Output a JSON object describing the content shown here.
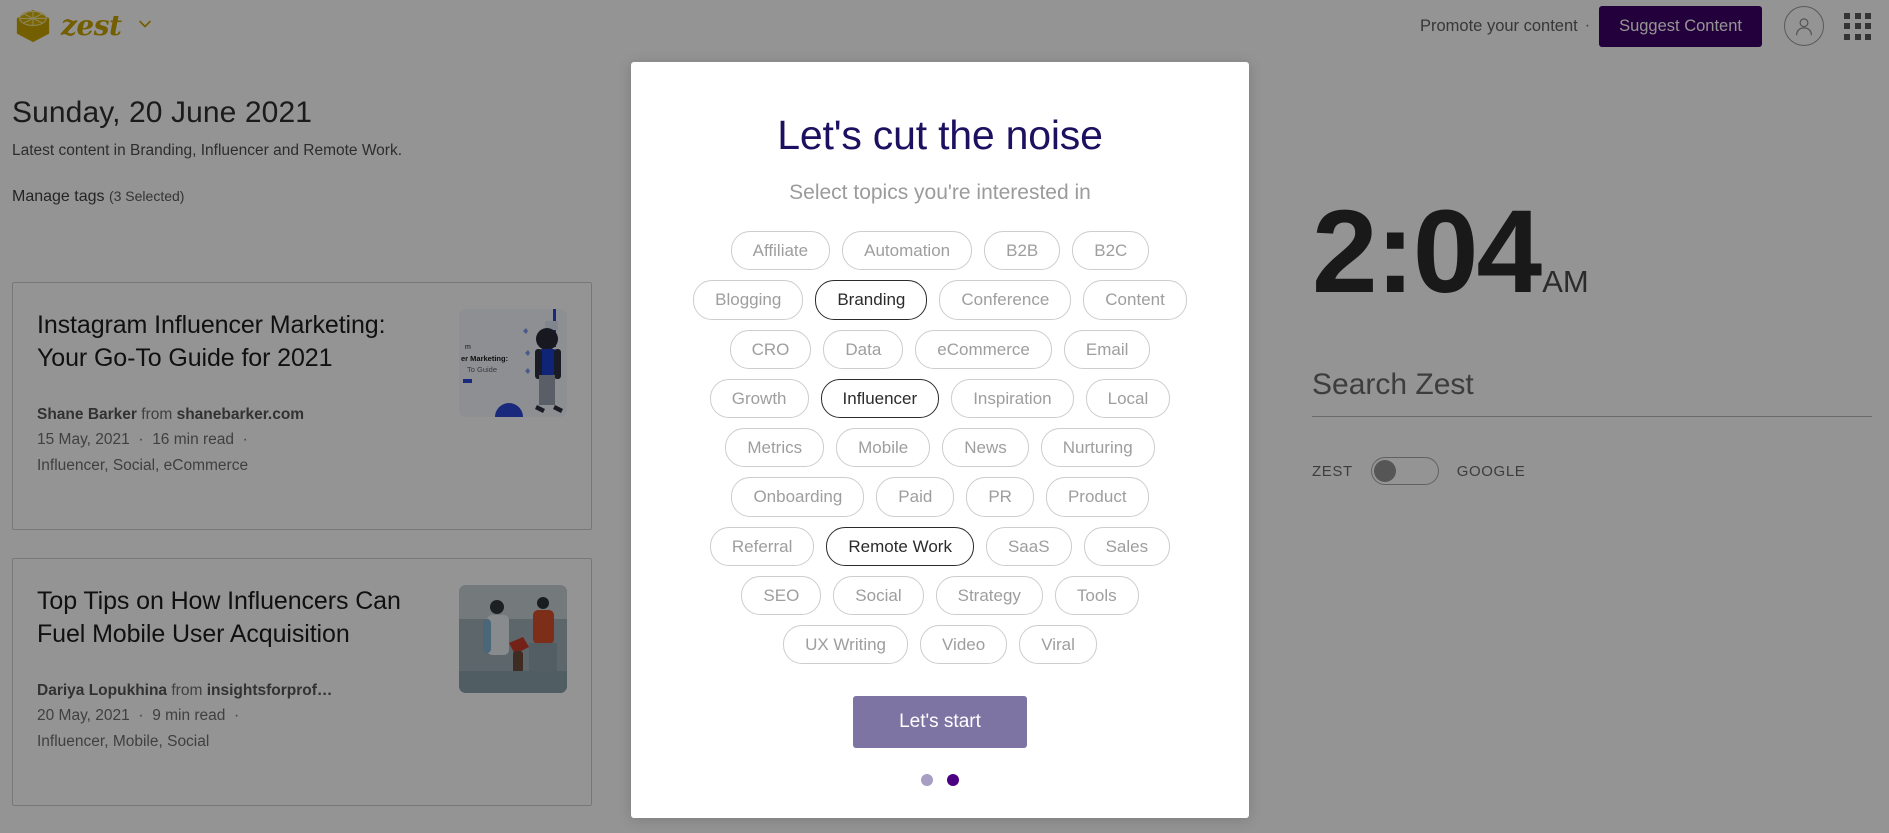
{
  "header": {
    "brand_name": "zest",
    "brand_caret_icon": "chevron-down-icon",
    "promote_label": "Promote your content",
    "separator": "·",
    "suggest_label": "Suggest Content",
    "avatar_icon": "user-avatar-icon",
    "apps_icon": "apps-grid-icon",
    "brand_color": "#c9a400",
    "suggest_bg": "#3d0066"
  },
  "left": {
    "date_title": "Sunday, 20 June 2021",
    "subtitle": "Latest content in Branding, Influencer and Remote Work.",
    "manage_tags_label": "Manage tags",
    "manage_tags_count": "(3 Selected)"
  },
  "cards": [
    {
      "title": "Instagram Influencer Marketing: Your Go-To Guide for 2021",
      "author": "Shane Barker",
      "from_word": "from",
      "source": "shanebarker.com",
      "date": "15 May, 2021",
      "read_time": "16 min read",
      "tags": "Influencer, Social, eCommerce",
      "thumb": "illustration-person-phone"
    },
    {
      "title": "Top Tips on How Influencers Can Fuel Mobile User Acquisition",
      "author": "Dariya Lopukhina",
      "from_word": "from",
      "source": "insightsforprof…",
      "date": "20 May, 2021",
      "read_time": "9 min read",
      "tags": "Influencer, Mobile, Social",
      "thumb": "photo-jetski"
    }
  ],
  "right": {
    "clock_time": "2:04",
    "clock_ampm": "AM",
    "search_placeholder": "Search Zest",
    "search_value": "",
    "toggle_left_label": "ZEST",
    "toggle_right_label": "GOOGLE",
    "toggle_state": "left"
  },
  "modal": {
    "title": "Let's cut the noise",
    "subtitle": "Select topics you're interested in",
    "start_label": "Let's start",
    "start_color": "#7d74a3",
    "selected_topics": [
      "Branding",
      "Influencer",
      "Remote Work"
    ],
    "topic_rows": [
      [
        "Affiliate",
        "Automation",
        "B2B",
        "B2C"
      ],
      [
        "Blogging",
        "Branding",
        "Conference",
        "Content"
      ],
      [
        "CRO",
        "Data",
        "eCommerce",
        "Email"
      ],
      [
        "Growth",
        "Influencer",
        "Inspiration",
        "Local"
      ],
      [
        "Metrics",
        "Mobile",
        "News",
        "Nurturing"
      ],
      [
        "Onboarding",
        "Paid",
        "PR",
        "Product"
      ],
      [
        "Referral",
        "Remote Work",
        "SaaS",
        "Sales"
      ],
      [
        "SEO",
        "Social",
        "Strategy",
        "Tools"
      ],
      [
        "UX Writing",
        "Video",
        "Viral"
      ]
    ],
    "dots": [
      {
        "active": false
      },
      {
        "active": true
      }
    ],
    "dot_active_color": "#4b0082",
    "dot_inactive_color": "#a79ec4"
  }
}
